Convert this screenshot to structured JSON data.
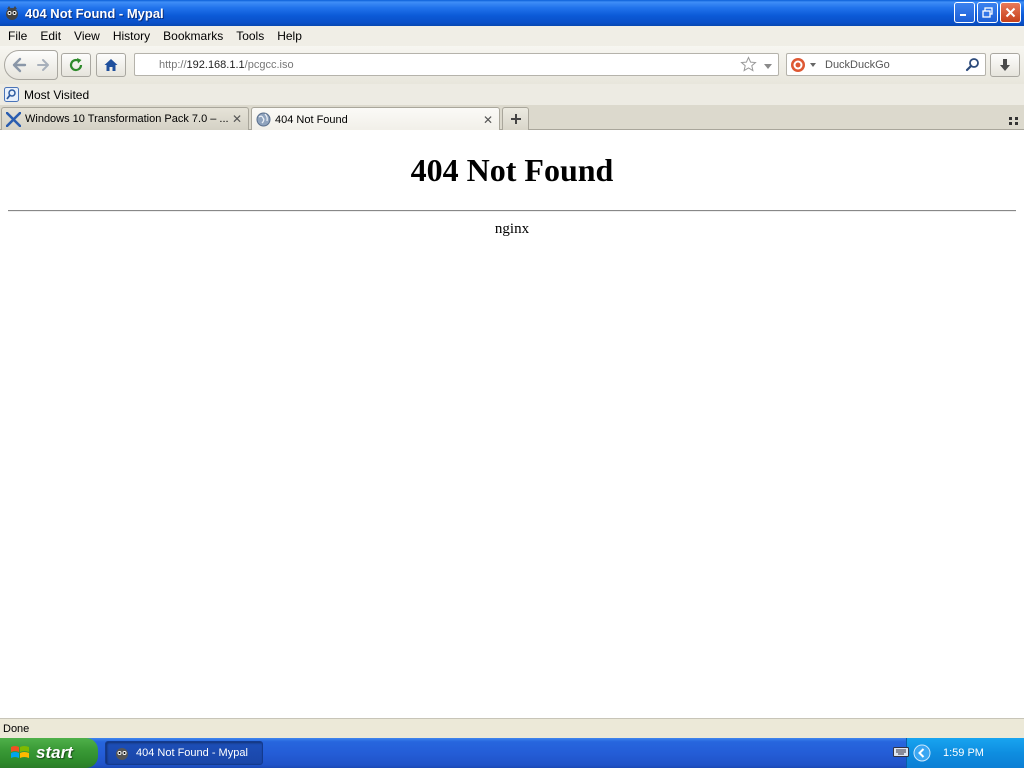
{
  "window": {
    "title": "404 Not Found - Mypal"
  },
  "menu": {
    "items": [
      "File",
      "Edit",
      "View",
      "History",
      "Bookmarks",
      "Tools",
      "Help"
    ]
  },
  "nav": {
    "url_scheme": "http://",
    "url_host": "192.168.1.1",
    "url_path": "/pcgcc.iso",
    "search_placeholder": "DuckDuckGo"
  },
  "bookmarks": {
    "most_visited": "Most Visited"
  },
  "tabs": [
    {
      "label": "Windows 10 Transformation Pack 7.0 – ...",
      "active": false
    },
    {
      "label": "404 Not Found",
      "active": true
    }
  ],
  "page": {
    "heading": "404 Not Found",
    "server": "nginx"
  },
  "status": {
    "text": "Done"
  },
  "taskbar": {
    "start_label": "start",
    "task_label": "404 Not Found - Mypal",
    "clock": "1:59 PM"
  },
  "colors": {
    "titlebar": "#0b5ad7",
    "taskbar": "#245dd7",
    "start": "#3a9a36",
    "tray": "#0e8ee0"
  }
}
